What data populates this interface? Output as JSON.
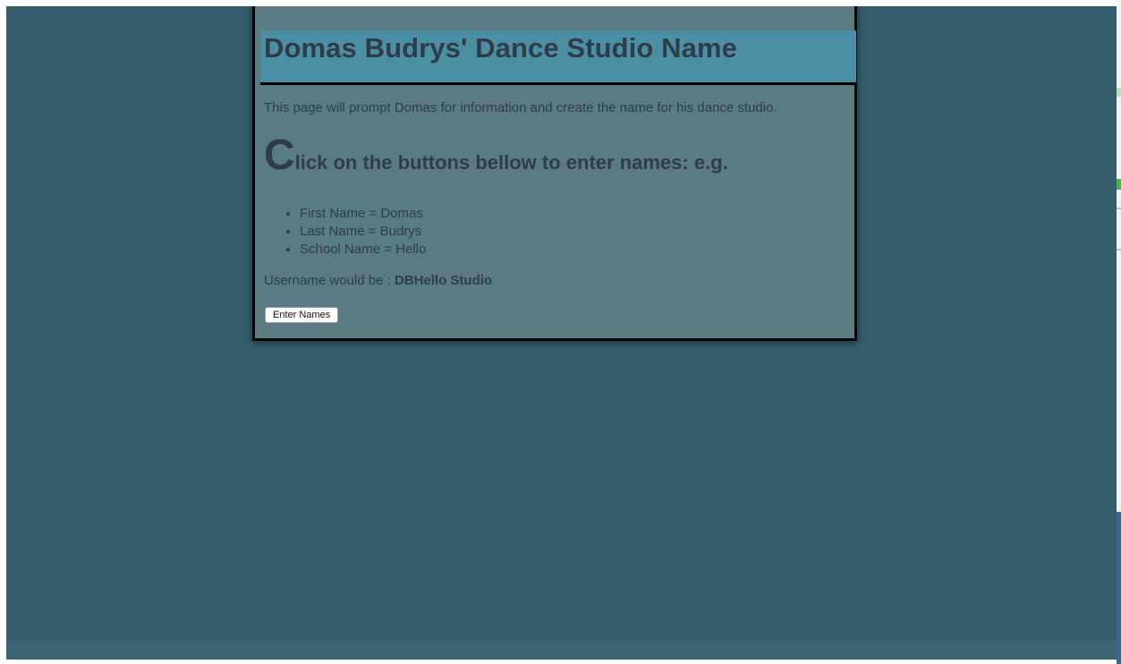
{
  "page": {
    "title": "Domas Budrys' Dance Studio Name",
    "intro": "This page will prompt Domas for information and create the name for his dance studio.",
    "instruction_dropcap": "C",
    "instruction_rest": "lick on the buttons bellow to enter names: e.g.",
    "examples": [
      "First Name = Domas",
      "Last Name = Budrys",
      "School Name = Hello"
    ],
    "username_label": "Username would be : ",
    "username_value": "DBHello Studio",
    "button_label": "Enter Names"
  },
  "colors": {
    "background": "#345e6e",
    "panel": "#5a7b82",
    "title_bar": "#4a8fa3",
    "text": "#2f3d48",
    "border": "#000000"
  }
}
